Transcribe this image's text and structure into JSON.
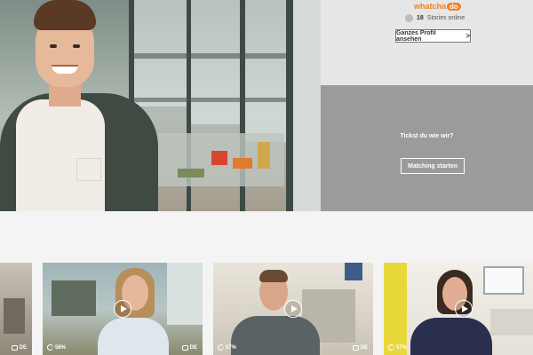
{
  "profile": {
    "logo_text": "whatcha",
    "logo_badge": "do",
    "stories_count": "18",
    "stories_label": "Stories online",
    "full_profile_button": "Ganzes Profil ansehen",
    "chevron": ">"
  },
  "matching": {
    "question": "Tickst du wie wir?",
    "button": "Matching starten"
  },
  "thumbnails": [
    {
      "percent": "",
      "language": "DE"
    },
    {
      "percent": "58%",
      "language": "DE"
    },
    {
      "percent": "57%",
      "language": "DE"
    },
    {
      "percent": "57%",
      "language": ""
    }
  ],
  "colors": {
    "brand_orange": "#f07f23",
    "matching_panel": "#9b9b9b",
    "profile_panel": "#e6e6e6",
    "page_background": "#f4f4f4"
  }
}
